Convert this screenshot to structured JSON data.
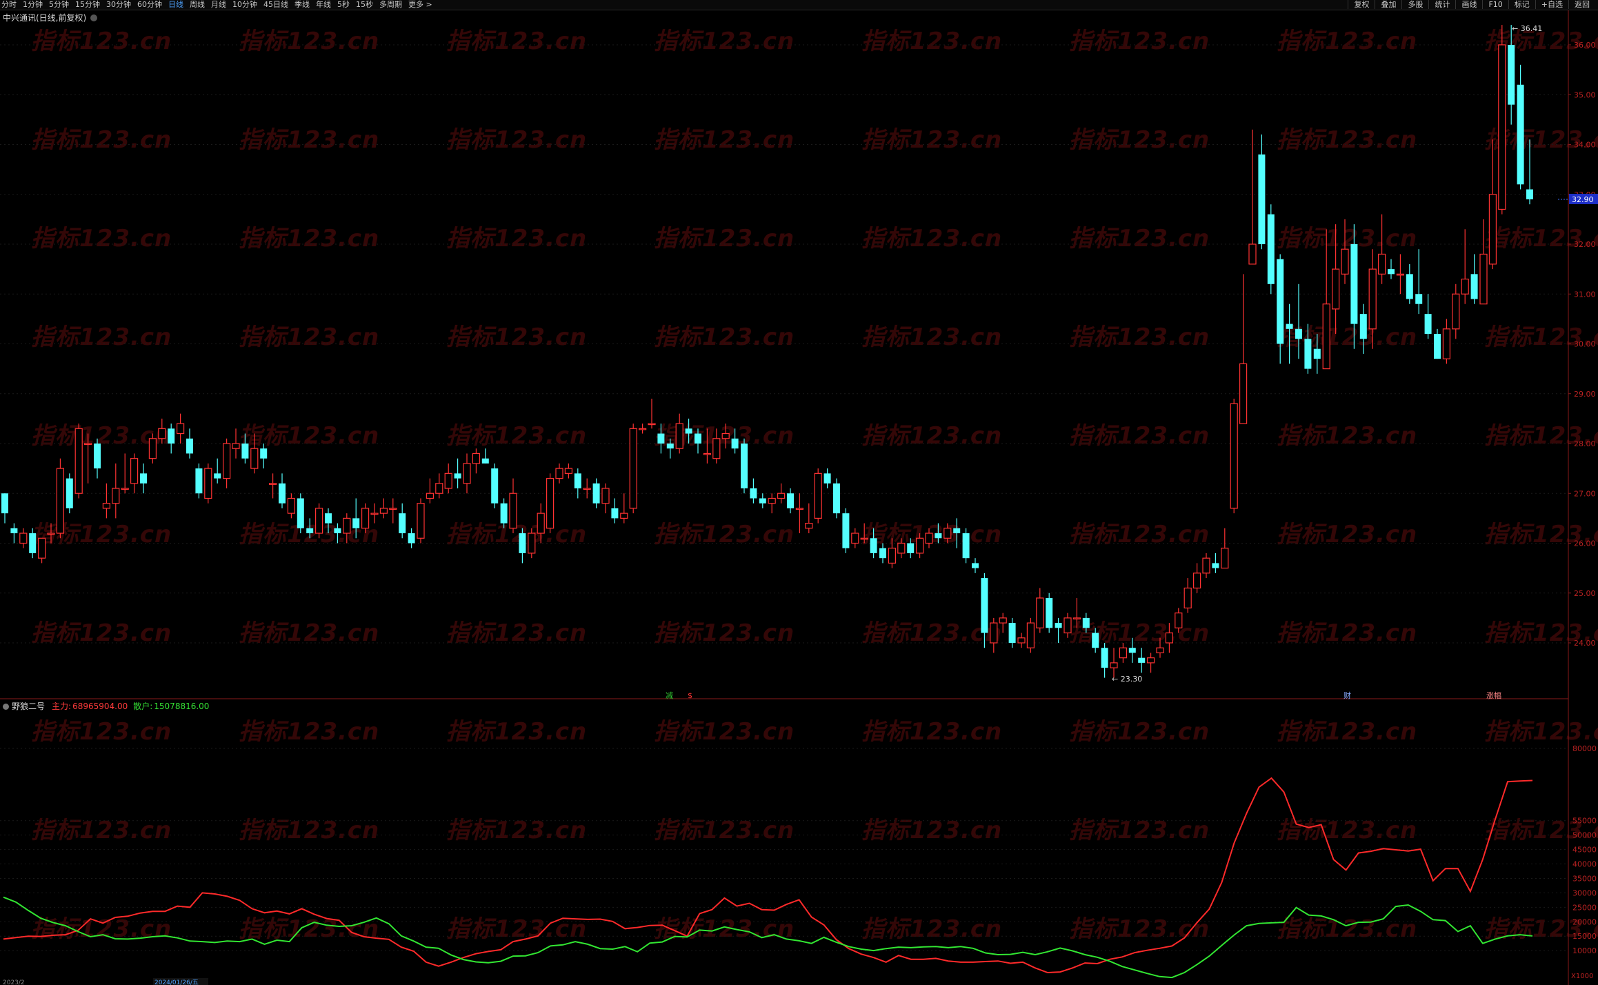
{
  "toolbar": {
    "periods": [
      "分时",
      "1分钟",
      "5分钟",
      "15分钟",
      "30分钟",
      "60分钟",
      "日线",
      "周线",
      "月线",
      "10分钟",
      "45日线",
      "季线",
      "年线",
      "5秒",
      "15秒",
      "多周期",
      "更多 >"
    ],
    "active_index": 6,
    "right": [
      "复权",
      "叠加",
      "多股",
      "统计",
      "画线",
      "F10",
      "标记",
      "+自选",
      "返回"
    ]
  },
  "stock_title": "中兴通讯(日线,前复权)",
  "indicator": {
    "name": "野狼二号",
    "main_label": "主力:",
    "main_value": "68965904.00",
    "retail_label": "散户:",
    "retail_value": "15078816.00"
  },
  "price_axis": {
    "ticks": [
      "36.00",
      "35.00",
      "34.00",
      "33.00",
      "32.00",
      "31.00",
      "30.00",
      "29.00",
      "28.00",
      "27.00",
      "26.00",
      "25.00",
      "24.00"
    ],
    "current_price": "32.90"
  },
  "indicator_axis": {
    "ticks": [
      "80000",
      "55000",
      "50000",
      "45000",
      "40000",
      "35000",
      "30000",
      "25000",
      "20000",
      "15000",
      "10000"
    ],
    "unit": "X1000"
  },
  "annotations": {
    "high_label": "36.41",
    "low_label": "23.30",
    "event_markers": [
      "减",
      "$",
      "财",
      "涨幅"
    ]
  },
  "date_labels": [
    "2023/2",
    "2024/01/26/五"
  ],
  "watermark": "指标123.cn",
  "colors": {
    "up": "#ff3232",
    "down": "#54ffff",
    "main_line": "#ff2a2a",
    "retail_line": "#32e632",
    "current_price_bg": "#1e2fc8"
  },
  "chart_data": {
    "type": "candlestick",
    "note_y_units": "price CNY",
    "candles": [
      [
        27.0,
        26.6,
        27.0,
        26.4
      ],
      [
        26.3,
        26.2,
        26.4,
        26.0
      ],
      [
        26.0,
        26.2,
        26.3,
        25.9
      ],
      [
        26.2,
        25.8,
        26.3,
        25.7
      ],
      [
        25.7,
        26.1,
        26.1,
        25.6
      ],
      [
        26.2,
        26.2,
        26.4,
        26.0
      ],
      [
        26.2,
        27.5,
        27.7,
        26.1
      ],
      [
        27.3,
        26.7,
        27.4,
        26.6
      ],
      [
        27.0,
        28.3,
        28.4,
        26.9
      ],
      [
        28.0,
        28.0,
        28.2,
        27.2
      ],
      [
        28.0,
        27.5,
        28.1,
        27.3
      ],
      [
        26.7,
        26.8,
        27.2,
        26.5
      ],
      [
        26.8,
        27.1,
        27.6,
        26.5
      ],
      [
        27.1,
        27.1,
        27.8,
        27.0
      ],
      [
        27.2,
        27.7,
        27.8,
        27.0
      ],
      [
        27.4,
        27.2,
        27.6,
        27.0
      ],
      [
        27.7,
        28.1,
        28.2,
        27.6
      ],
      [
        28.1,
        28.3,
        28.5,
        28.0
      ],
      [
        28.3,
        28.0,
        28.4,
        27.8
      ],
      [
        28.2,
        28.4,
        28.6,
        28.0
      ],
      [
        28.1,
        27.8,
        28.3,
        27.7
      ],
      [
        27.5,
        27.0,
        27.6,
        26.9
      ],
      [
        26.9,
        27.5,
        27.6,
        26.8
      ],
      [
        27.4,
        27.3,
        27.7,
        27.2
      ],
      [
        27.3,
        28.0,
        28.1,
        27.1
      ],
      [
        27.9,
        28.0,
        28.3,
        27.7
      ],
      [
        28.0,
        27.7,
        28.2,
        27.6
      ],
      [
        27.5,
        27.9,
        28.2,
        27.4
      ],
      [
        27.9,
        27.7,
        28.0,
        27.5
      ],
      [
        27.2,
        27.2,
        27.4,
        26.9
      ],
      [
        27.2,
        26.8,
        27.4,
        26.7
      ],
      [
        26.6,
        26.9,
        27.0,
        26.5
      ],
      [
        26.9,
        26.3,
        27.0,
        26.2
      ],
      [
        26.3,
        26.2,
        26.5,
        26.1
      ],
      [
        26.2,
        26.7,
        26.8,
        26.1
      ],
      [
        26.6,
        26.4,
        26.7,
        26.2
      ],
      [
        26.3,
        26.2,
        26.4,
        26.0
      ],
      [
        26.2,
        26.5,
        26.6,
        26.0
      ],
      [
        26.5,
        26.3,
        26.9,
        26.1
      ],
      [
        26.3,
        26.7,
        26.8,
        26.2
      ],
      [
        26.6,
        26.6,
        26.8,
        26.4
      ],
      [
        26.6,
        26.7,
        26.9,
        26.5
      ],
      [
        26.7,
        26.7,
        26.9,
        26.4
      ],
      [
        26.6,
        26.2,
        26.8,
        26.1
      ],
      [
        26.2,
        26.0,
        26.3,
        25.9
      ],
      [
        26.1,
        26.8,
        26.9,
        26.0
      ],
      [
        26.9,
        27.0,
        27.3,
        26.8
      ],
      [
        27.0,
        27.2,
        27.4,
        26.9
      ],
      [
        27.1,
        27.4,
        27.6,
        27.0
      ],
      [
        27.4,
        27.3,
        27.7,
        27.1
      ],
      [
        27.2,
        27.6,
        27.8,
        27.0
      ],
      [
        27.6,
        27.8,
        27.9,
        27.4
      ],
      [
        27.7,
        27.6,
        27.9,
        27.6
      ],
      [
        27.5,
        26.8,
        27.6,
        26.7
      ],
      [
        26.8,
        26.4,
        26.9,
        26.3
      ],
      [
        26.3,
        27.0,
        27.3,
        26.2
      ],
      [
        26.2,
        25.8,
        26.3,
        25.6
      ],
      [
        25.8,
        26.2,
        26.3,
        25.7
      ],
      [
        26.2,
        26.6,
        26.8,
        26.0
      ],
      [
        26.3,
        27.3,
        27.4,
        26.2
      ],
      [
        27.3,
        27.5,
        27.6,
        27.2
      ],
      [
        27.4,
        27.5,
        27.6,
        27.3
      ],
      [
        27.4,
        27.1,
        27.5,
        26.9
      ],
      [
        27.1,
        27.1,
        27.3,
        26.9
      ],
      [
        27.2,
        26.8,
        27.3,
        26.7
      ],
      [
        26.8,
        27.1,
        27.2,
        26.6
      ],
      [
        26.7,
        26.5,
        26.9,
        26.4
      ],
      [
        26.5,
        26.6,
        27.0,
        26.4
      ],
      [
        26.7,
        28.3,
        28.4,
        26.6
      ],
      [
        28.3,
        28.3,
        28.4,
        28.2
      ],
      [
        28.4,
        28.4,
        28.9,
        28.3
      ],
      [
        28.2,
        28.0,
        28.4,
        27.8
      ],
      [
        28.0,
        27.9,
        28.1,
        27.7
      ],
      [
        27.9,
        28.4,
        28.6,
        27.8
      ],
      [
        28.3,
        28.2,
        28.5,
        28.0
      ],
      [
        28.2,
        28.0,
        28.3,
        27.8
      ],
      [
        27.8,
        27.8,
        28.3,
        27.6
      ],
      [
        27.7,
        28.1,
        28.3,
        27.6
      ],
      [
        28.1,
        28.2,
        28.4,
        27.9
      ],
      [
        28.1,
        27.9,
        28.3,
        27.8
      ],
      [
        28.0,
        27.1,
        28.1,
        27.0
      ],
      [
        27.1,
        26.9,
        27.3,
        26.8
      ],
      [
        26.9,
        26.8,
        27.0,
        26.7
      ],
      [
        26.8,
        26.9,
        27.0,
        26.6
      ],
      [
        26.9,
        27.0,
        27.2,
        26.8
      ],
      [
        27.0,
        26.7,
        27.1,
        26.6
      ],
      [
        26.7,
        26.7,
        27.0,
        26.2
      ],
      [
        26.3,
        26.4,
        26.8,
        26.2
      ],
      [
        26.5,
        27.4,
        27.5,
        26.4
      ],
      [
        27.4,
        27.2,
        27.5,
        27.1
      ],
      [
        27.2,
        26.6,
        27.3,
        26.5
      ],
      [
        26.6,
        25.9,
        26.7,
        25.8
      ],
      [
        26.0,
        26.2,
        26.3,
        25.9
      ],
      [
        26.1,
        26.1,
        26.4,
        26.0
      ],
      [
        26.1,
        25.8,
        26.3,
        25.7
      ],
      [
        25.9,
        25.7,
        26.0,
        25.6
      ],
      [
        25.6,
        25.9,
        26.1,
        25.5
      ],
      [
        25.8,
        26.0,
        26.1,
        25.7
      ],
      [
        26.0,
        25.8,
        26.1,
        25.7
      ],
      [
        25.8,
        26.1,
        26.2,
        25.7
      ],
      [
        26.0,
        26.2,
        26.3,
        25.9
      ],
      [
        26.2,
        26.1,
        26.4,
        26.0
      ],
      [
        26.1,
        26.3,
        26.4,
        26.0
      ],
      [
        26.3,
        26.2,
        26.5,
        25.9
      ],
      [
        26.2,
        25.7,
        26.3,
        25.6
      ],
      [
        25.6,
        25.5,
        25.7,
        25.4
      ],
      [
        25.3,
        24.2,
        25.4,
        23.9
      ],
      [
        24.0,
        24.4,
        24.5,
        23.8
      ],
      [
        24.4,
        24.5,
        24.6,
        24.2
      ],
      [
        24.4,
        24.0,
        24.5,
        23.9
      ],
      [
        24.0,
        24.1,
        24.2,
        23.9
      ],
      [
        23.9,
        24.4,
        24.5,
        23.8
      ],
      [
        24.3,
        24.9,
        25.1,
        24.2
      ],
      [
        24.9,
        24.3,
        25.0,
        24.2
      ],
      [
        24.4,
        24.3,
        24.5,
        24.0
      ],
      [
        24.2,
        24.5,
        24.6,
        24.1
      ],
      [
        24.5,
        24.5,
        24.9,
        24.3
      ],
      [
        24.5,
        24.3,
        24.6,
        24.2
      ],
      [
        24.2,
        23.9,
        24.3,
        23.8
      ],
      [
        23.9,
        23.5,
        24.0,
        23.3
      ],
      [
        23.5,
        23.6,
        23.9,
        23.3
      ],
      [
        23.7,
        23.9,
        24.0,
        23.6
      ],
      [
        23.9,
        23.8,
        24.1,
        23.6
      ],
      [
        23.7,
        23.6,
        23.9,
        23.4
      ],
      [
        23.6,
        23.7,
        23.8,
        23.4
      ],
      [
        23.8,
        23.9,
        24.1,
        23.7
      ],
      [
        24.0,
        24.2,
        24.4,
        23.8
      ],
      [
        24.3,
        24.6,
        24.7,
        24.2
      ],
      [
        24.7,
        25.1,
        25.3,
        24.6
      ],
      [
        25.1,
        25.4,
        25.6,
        25.0
      ],
      [
        25.4,
        25.7,
        25.8,
        25.3
      ],
      [
        25.6,
        25.5,
        25.8,
        25.4
      ],
      [
        25.5,
        25.9,
        26.3,
        25.5
      ],
      [
        26.7,
        28.8,
        28.9,
        26.6
      ],
      [
        28.4,
        29.6,
        31.4,
        29.0
      ],
      [
        31.6,
        32.0,
        34.3,
        32.0
      ],
      [
        33.8,
        32.0,
        34.2,
        31.9
      ],
      [
        32.6,
        31.2,
        32.8,
        31.0
      ],
      [
        31.7,
        30.0,
        31.8,
        29.6
      ],
      [
        30.4,
        30.3,
        30.8,
        29.6
      ],
      [
        30.3,
        30.1,
        31.2,
        29.7
      ],
      [
        30.1,
        29.5,
        30.4,
        29.4
      ],
      [
        29.9,
        29.7,
        30.2,
        29.4
      ],
      [
        29.5,
        30.8,
        32.3,
        29.5
      ],
      [
        30.7,
        31.5,
        32.4,
        30.2
      ],
      [
        31.4,
        31.9,
        32.5,
        31.2
      ],
      [
        32.0,
        30.4,
        32.4,
        29.9
      ],
      [
        30.6,
        30.1,
        30.8,
        29.8
      ],
      [
        30.3,
        31.5,
        31.9,
        29.9
      ],
      [
        31.4,
        31.8,
        32.6,
        31.2
      ],
      [
        31.5,
        31.4,
        31.7,
        31.3
      ],
      [
        31.4,
        31.4,
        31.8,
        31.0
      ],
      [
        31.4,
        30.9,
        31.6,
        30.8
      ],
      [
        31.0,
        30.8,
        31.9,
        30.6
      ],
      [
        30.6,
        30.2,
        31.0,
        30.1
      ],
      [
        30.2,
        29.7,
        30.3,
        29.7
      ],
      [
        29.7,
        30.3,
        30.5,
        29.6
      ],
      [
        30.3,
        31.0,
        31.2,
        30.1
      ],
      [
        31.0,
        31.3,
        32.3,
        30.8
      ],
      [
        31.4,
        30.9,
        31.8,
        30.8
      ],
      [
        30.8,
        31.8,
        32.5,
        30.9
      ],
      [
        31.6,
        33.0,
        34.1,
        31.5
      ],
      [
        32.7,
        36.0,
        36.4,
        32.6
      ],
      [
        36.0,
        34.8,
        36.4,
        34.4
      ],
      [
        35.2,
        33.2,
        35.6,
        33.1
      ],
      [
        33.1,
        32.9,
        34.1,
        32.8
      ]
    ],
    "series": [
      {
        "name": "主力",
        "values": [
          14000,
          14500,
          15000,
          14900,
          15300,
          15500,
          17000,
          21000,
          19500,
          21500,
          21900,
          23000,
          23600,
          23600,
          25400,
          25000,
          30000,
          29600,
          28800,
          27400,
          24500,
          23100,
          23700,
          22700,
          24500,
          22600,
          21100,
          20500,
          16300,
          14800,
          14300,
          13900,
          11200,
          9800,
          6000,
          4600,
          6000,
          7600,
          8900,
          9700,
          10300,
          13100,
          14000,
          15100,
          19500,
          21200,
          21000,
          20800,
          20900,
          20100,
          17600,
          18000,
          18700,
          18800,
          16900,
          15000,
          22800,
          24200,
          28200,
          25400,
          26400,
          24200,
          24000,
          26000,
          27600,
          21600,
          18900,
          13800,
          10700,
          8800,
          7600,
          6000,
          8300,
          7000,
          7000,
          7300,
          6400,
          6000,
          6000,
          6200,
          6400,
          5600,
          6000,
          4000,
          2400,
          2600,
          4000,
          5700,
          5500,
          7000,
          7800,
          9300,
          10100,
          10800,
          11600,
          14400,
          19600,
          24400,
          33600,
          47200,
          57500,
          66600,
          69700,
          64900,
          53800,
          52600,
          53600,
          41500,
          37900,
          43800,
          44400,
          45300,
          44900,
          44500,
          45100,
          34200,
          38400,
          38400,
          30500,
          41600,
          55400,
          68500,
          68700,
          68900
        ]
      },
      {
        "name": "散户",
        "values": [
          28500,
          26800,
          23900,
          21200,
          19700,
          18600,
          16600,
          14800,
          15500,
          14100,
          14000,
          14300,
          14800,
          15100,
          14400,
          13300,
          13100,
          12800,
          13300,
          13100,
          14000,
          12200,
          13600,
          13100,
          17900,
          19800,
          18800,
          18400,
          18600,
          19800,
          21300,
          19300,
          15100,
          13300,
          11200,
          10800,
          8500,
          6900,
          6100,
          5800,
          6300,
          8100,
          8200,
          9300,
          11600,
          12000,
          13100,
          12200,
          10700,
          10500,
          11400,
          9600,
          12600,
          13000,
          14900,
          14700,
          17100,
          16800,
          18200,
          17300,
          16500,
          14500,
          15500,
          14000,
          13400,
          12500,
          14600,
          12900,
          11400,
          10500,
          10000,
          10700,
          11200,
          11000,
          11300,
          11400,
          11000,
          11400,
          10800,
          9200,
          8600,
          8700,
          9400,
          8600,
          9600,
          10900,
          9900,
          8600,
          7700,
          6300,
          4500,
          3300,
          2100,
          1000,
          700,
          2400,
          5100,
          8100,
          11800,
          15400,
          18600,
          19400,
          19600,
          19800,
          24900,
          22300,
          22000,
          20700,
          18600,
          19800,
          19900,
          21000,
          25300,
          25800,
          23600,
          20700,
          20400,
          16600,
          18600,
          12500,
          14000,
          15100,
          15500,
          15078
        ]
      }
    ]
  }
}
